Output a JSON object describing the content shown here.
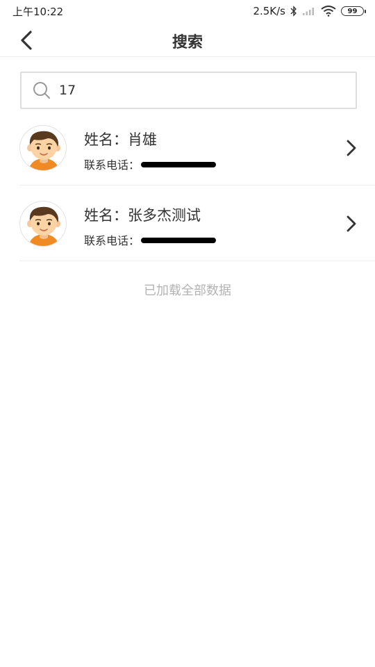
{
  "status_bar": {
    "time": "上午10:22",
    "network_speed": "2.5K/s",
    "battery": "99",
    "icons": [
      "bluetooth-icon",
      "signal-icon",
      "wifi-icon",
      "battery-icon"
    ]
  },
  "nav": {
    "title": "搜索",
    "back_icon": "back-chevron-icon"
  },
  "search": {
    "value": "17",
    "icon": "search-icon"
  },
  "results": [
    {
      "name_label": "姓名：",
      "name": "肖雄",
      "phone_label": "联系电话：",
      "phone_redacted": true
    },
    {
      "name_label": "姓名：",
      "name": "张多杰测试",
      "phone_label": "联系电话：",
      "phone_redacted": true
    }
  ],
  "footer": {
    "load_all": "已加载全部数据"
  },
  "colors": {
    "text": "#333333",
    "divider": "#eeeeee",
    "muted": "#b3b3b3",
    "avatar_shirt": "#f08a24",
    "avatar_hair": "#5a3a1e",
    "avatar_skin": "#fbd3a5"
  }
}
